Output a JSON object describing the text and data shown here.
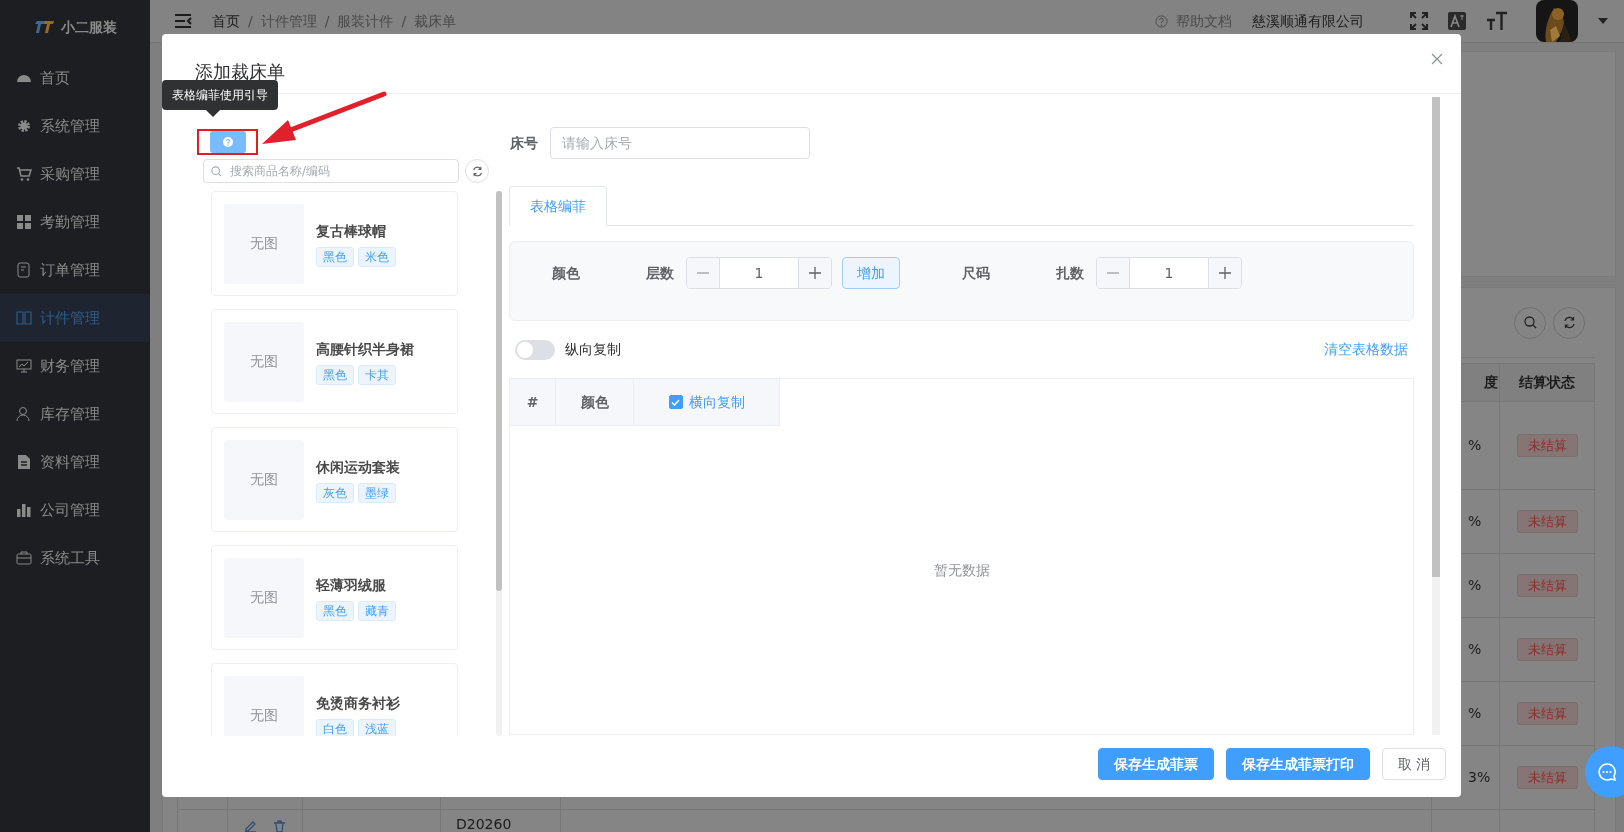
{
  "app": {
    "logo_text": "小二服装"
  },
  "sidebar": {
    "items": [
      {
        "label": "首页",
        "selected": false
      },
      {
        "label": "系统管理",
        "selected": false
      },
      {
        "label": "采购管理",
        "selected": false
      },
      {
        "label": "考勤管理",
        "selected": false
      },
      {
        "label": "订单管理",
        "selected": false
      },
      {
        "label": "计件管理",
        "selected": true
      },
      {
        "label": "财务管理",
        "selected": false
      },
      {
        "label": "库存管理",
        "selected": false
      },
      {
        "label": "资料管理",
        "selected": false
      },
      {
        "label": "公司管理",
        "selected": false
      },
      {
        "label": "系统工具",
        "selected": false
      }
    ]
  },
  "header": {
    "breadcrumb": [
      "首页",
      "计件管理",
      "服装计件",
      "裁床单"
    ],
    "separator": "/",
    "help": "帮助文档",
    "company": "慈溪顺通有限公司"
  },
  "background_table": {
    "columns": [
      "度",
      "结算状态"
    ],
    "rows": [
      {
        "progress": "%",
        "status": "未结算"
      },
      {
        "progress": "%",
        "status": "未结算"
      },
      {
        "progress": "%",
        "status": "未结算"
      },
      {
        "progress": "%",
        "status": "未结算"
      },
      {
        "progress": "%",
        "status": "未结算"
      },
      {
        "progress": "3%",
        "status": "未结算"
      }
    ],
    "last_row_code": "D20260"
  },
  "tooltip": "表格编菲使用引导",
  "modal": {
    "title": "添加裁床单",
    "search": {
      "placeholder": "搜索商品名称/编码"
    },
    "products": [
      {
        "name": "复古棒球帽",
        "image": "无图",
        "tags": [
          "黑色",
          "米色"
        ]
      },
      {
        "name": "高腰针织半身裙",
        "image": "无图",
        "tags": [
          "黑色",
          "卡其"
        ]
      },
      {
        "name": "休闲运动套装",
        "image": "无图",
        "tags": [
          "灰色",
          "墨绿"
        ]
      },
      {
        "name": "轻薄羽绒服",
        "image": "无图",
        "tags": [
          "黑色",
          "藏青"
        ]
      },
      {
        "name": "免烫商务衬衫",
        "image": "无图",
        "tags": [
          "白色",
          "浅蓝"
        ]
      }
    ],
    "bed_no": {
      "label": "床号",
      "placeholder": "请输入床号"
    },
    "tabs": [
      {
        "label": "表格编菲",
        "selected": true
      }
    ],
    "controls": {
      "color_label": "颜色",
      "layers": {
        "label": "层数",
        "value": "1"
      },
      "add_button": "增加",
      "size_label": "尺码",
      "bundles": {
        "label": "扎数",
        "value": "1"
      }
    },
    "vertical_copy": {
      "label": "纵向复制",
      "on": false
    },
    "clear_link": "清空表格数据",
    "table": {
      "columns": [
        {
          "label": "#",
          "kind": "text"
        },
        {
          "label": "颜色",
          "kind": "text"
        },
        {
          "label": "横向复制",
          "kind": "checkbox",
          "checked": true
        }
      ],
      "empty_text": "暂无数据"
    },
    "buttons": [
      {
        "label": "保存生成菲票",
        "kind": "primary"
      },
      {
        "label": "保存生成菲票打印",
        "kind": "primary"
      },
      {
        "label": "取 消",
        "kind": "default"
      }
    ]
  }
}
